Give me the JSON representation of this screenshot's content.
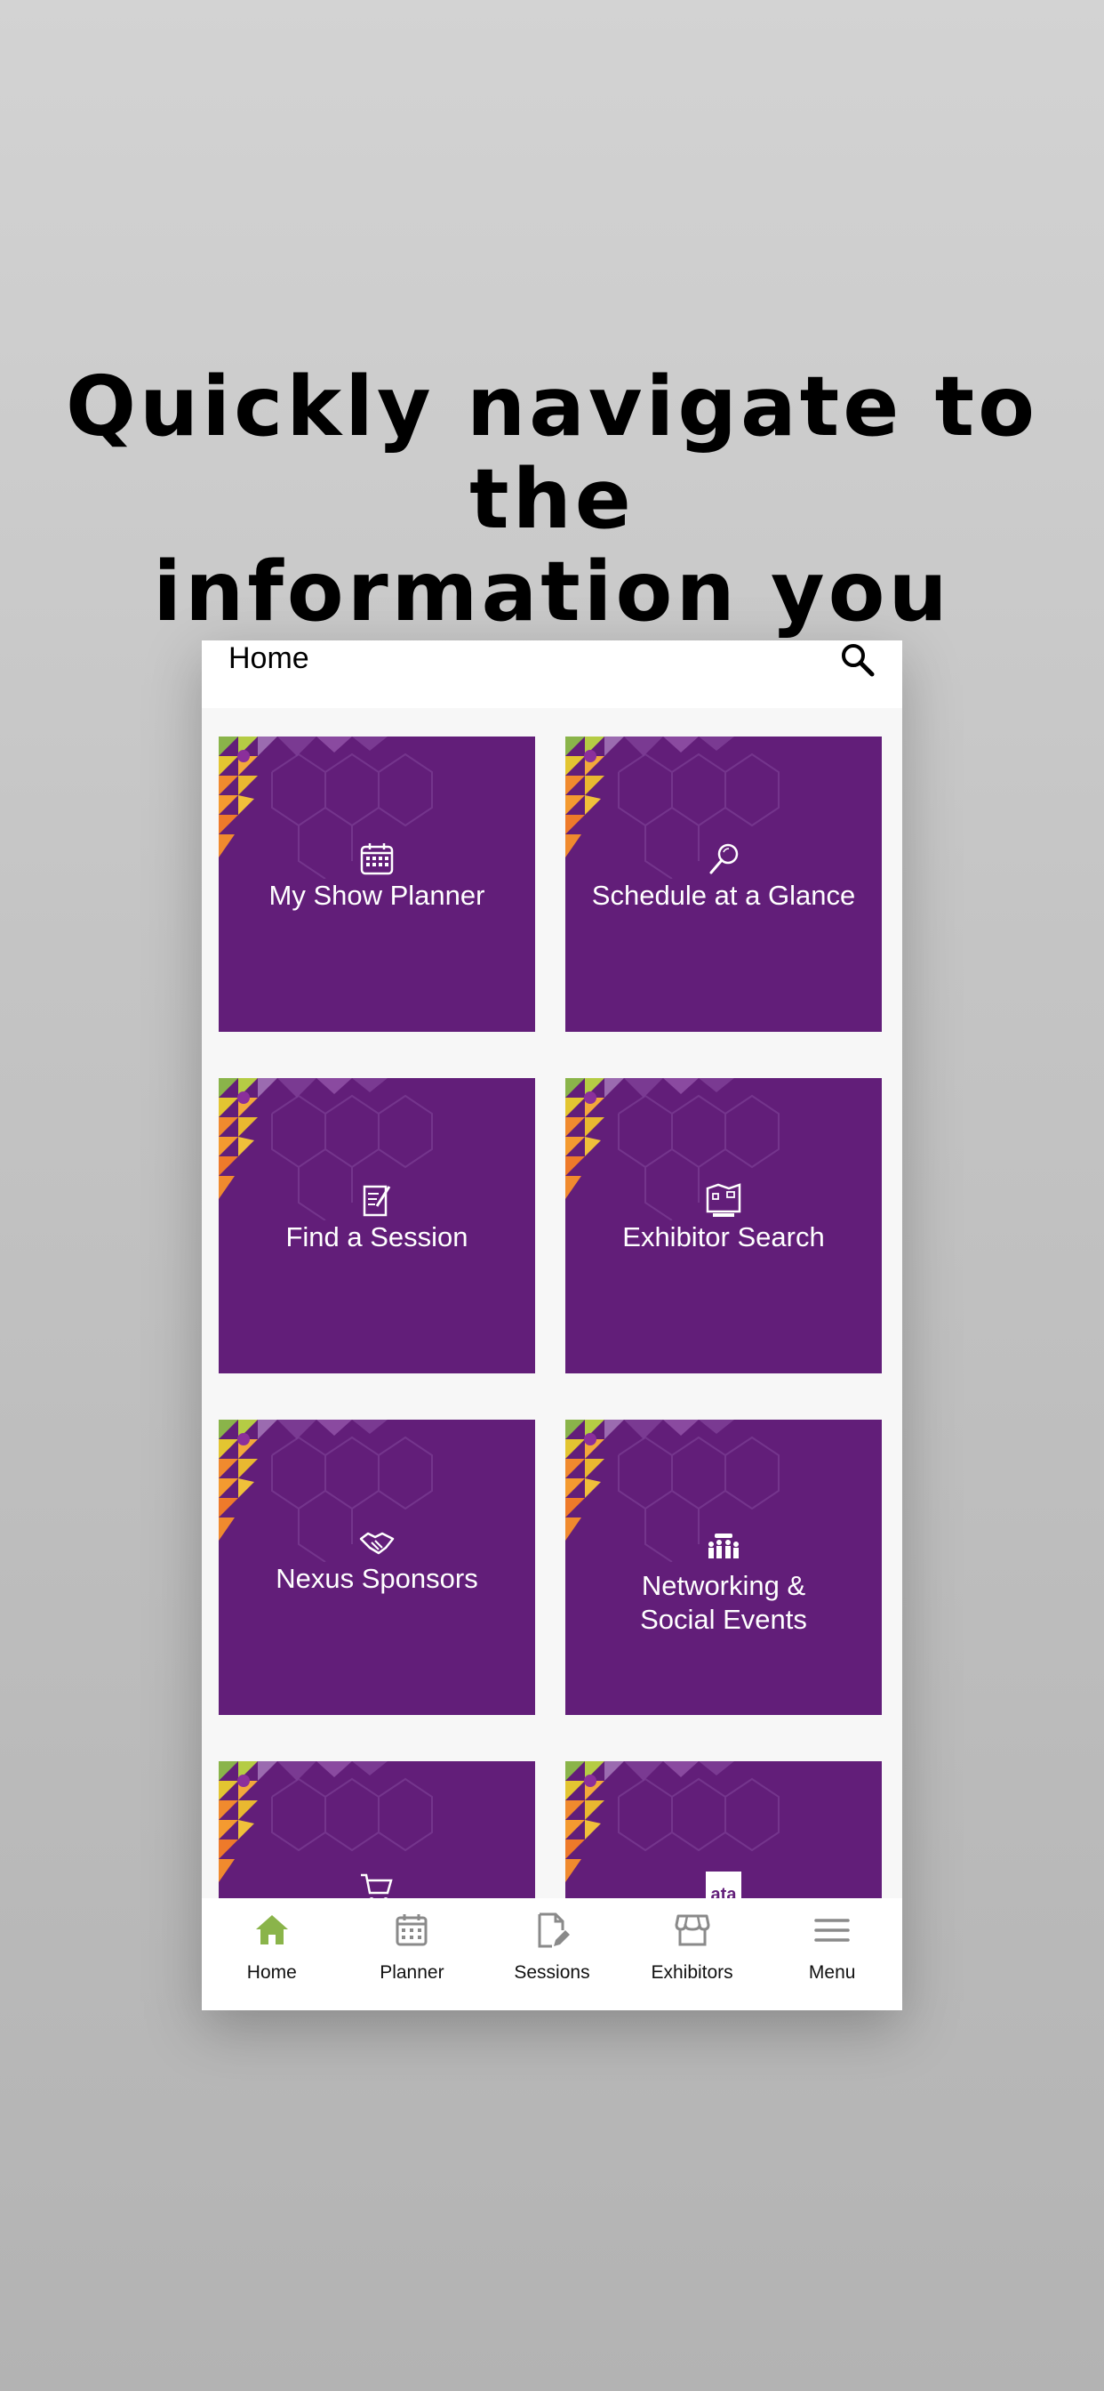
{
  "headline": {
    "line1": "Quickly navigate to the",
    "line2": "information you want."
  },
  "header": {
    "title": "Home",
    "search_icon": "search-icon"
  },
  "tiles": [
    {
      "label": "My Show Planner",
      "icon": "calendar-icon"
    },
    {
      "label": "Schedule at a Glance",
      "icon": "magnifier-icon"
    },
    {
      "label": "Find a Session",
      "icon": "document-pencil-icon"
    },
    {
      "label": "Exhibitor Search",
      "icon": "floor-map-icon"
    },
    {
      "label": "Nexus Sponsors",
      "icon": "handshake-icon"
    },
    {
      "label": "Networking &",
      "label2": "Social Events",
      "icon": "people-group-icon"
    },
    {
      "label": "",
      "icon": "cart-icon"
    },
    {
      "label": "",
      "icon": "ata-logo-icon",
      "logo_text": "ata"
    }
  ],
  "tabbar": {
    "items": [
      {
        "label": "Home",
        "icon": "home-icon",
        "active": true
      },
      {
        "label": "Planner",
        "icon": "calendar-icon",
        "active": false
      },
      {
        "label": "Sessions",
        "icon": "document-edit-icon",
        "active": false
      },
      {
        "label": "Exhibitors",
        "icon": "storefront-icon",
        "active": false
      },
      {
        "label": "Menu",
        "icon": "hamburger-menu-icon",
        "active": false
      }
    ]
  },
  "colors": {
    "tile_purple": "#621e79",
    "accent_green": "#8ab44a",
    "tab_inactive": "#8a8a8a"
  }
}
